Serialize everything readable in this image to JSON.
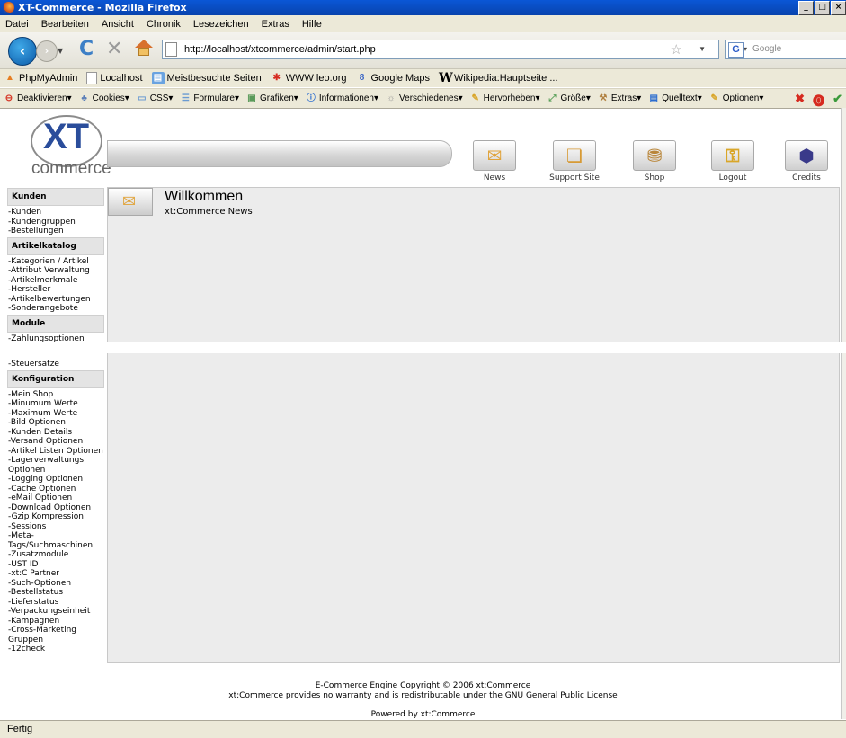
{
  "window": {
    "title": "XT-Commerce - Mozilla Firefox",
    "min": "_",
    "max": "□",
    "close": "×"
  },
  "menu": [
    "Datei",
    "Bearbeiten",
    "Ansicht",
    "Chronik",
    "Lesezeichen",
    "Extras",
    "Hilfe"
  ],
  "navbar": {
    "url": "http://localhost/xtcommerce/admin/start.php",
    "search_placeholder": "Google"
  },
  "bookmarks": [
    {
      "label": "PhpMyAdmin",
      "icon": "pma-icon"
    },
    {
      "label": "Localhost",
      "icon": "page-icon"
    },
    {
      "label": "Meistbesuchte Seiten",
      "icon": "folder-icon"
    },
    {
      "label": "WWW leo.org",
      "icon": "leo-icon"
    },
    {
      "label": "Google Maps",
      "icon": "maps-icon"
    },
    {
      "label": "Wikipedia:Hauptseite ...",
      "icon": "wikipedia-icon"
    }
  ],
  "devtoolbar": [
    "Deaktivieren",
    "Cookies",
    "CSS",
    "Formulare",
    "Grafiken",
    "Informationen",
    "Verschiedenes",
    "Hervorheben",
    "Größe",
    "Extras",
    "Quelltext",
    "Optionen"
  ],
  "logo": {
    "xt": "XT",
    "commerce": "commerce"
  },
  "header_nav": [
    {
      "label": "News",
      "icon": "news-icon"
    },
    {
      "label": "Support Site",
      "icon": "support-icon"
    },
    {
      "label": "Shop",
      "icon": "shop-icon"
    },
    {
      "label": "Logout",
      "icon": "logout-icon"
    },
    {
      "label": "Credits",
      "icon": "credits-icon"
    }
  ],
  "sidebar": {
    "kunden": {
      "title": "Kunden",
      "items": [
        "-Kunden",
        "-Kundengruppen",
        "-Bestellungen"
      ]
    },
    "artikel": {
      "title": "Artikelkatalog",
      "items": [
        "-Kategorien / Artikel",
        "-Attribut Verwaltung",
        "-Artikelmerkmale",
        "-Hersteller",
        "-Artikelbewertungen",
        "-Sonderangebote"
      ]
    },
    "module": {
      "title": "Module",
      "items": [
        "-Zahlungsoptionen"
      ]
    },
    "after_gap": [
      "-Steuersätze"
    ],
    "konfig": {
      "title": "Konfiguration",
      "items": [
        "-Mein Shop",
        "-Minumum Werte",
        "-Maximum Werte",
        "-Bild Optionen",
        "-Kunden Details",
        "-Versand Optionen",
        "-Artikel Listen Optionen",
        "-Lagerverwaltungs Optionen",
        "-Logging Optionen",
        "-Cache Optionen",
        "-eMail Optionen",
        "-Download Optionen",
        "-Gzip Kompression",
        "-Sessions",
        "-Meta-Tags/Suchmaschinen",
        "-Zusatzmodule",
        "-UST ID",
        "-xt:C Partner",
        "-Such-Optionen",
        "-Bestellstatus",
        "-Lieferstatus",
        "-Verpackungseinheit",
        "-Kampagnen",
        "-Cross-Marketing Gruppen",
        "-12check"
      ]
    }
  },
  "main": {
    "title": "Willkommen",
    "subtitle": "xt:Commerce News"
  },
  "footer": {
    "line1": "E-Commerce Engine Copyright © 2006 xt:Commerce",
    "line2": "xt:Commerce provides no warranty and is redistributable under the GNU General Public License",
    "line3": "Powered by xt:Commerce"
  },
  "status": "Fertig"
}
